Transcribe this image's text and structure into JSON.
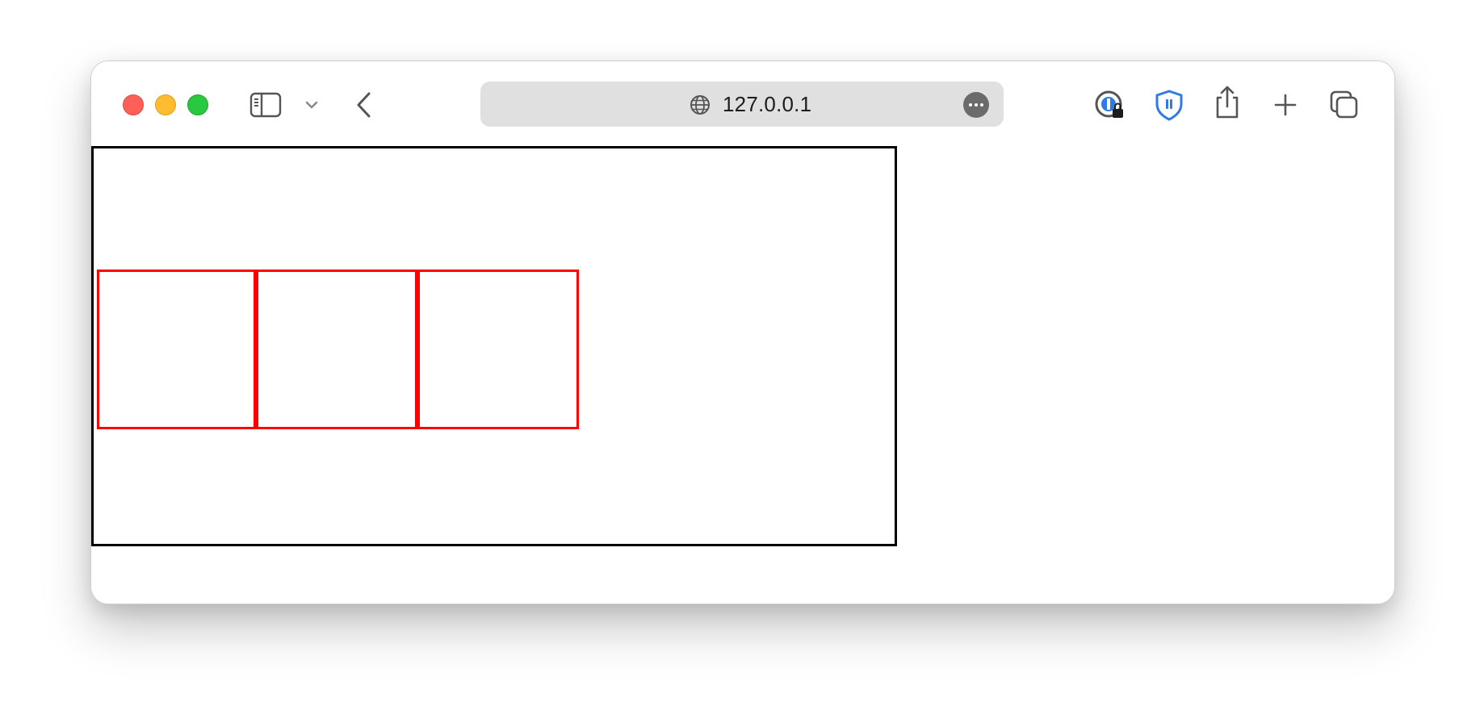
{
  "browser": {
    "address_bar": {
      "url": "127.0.0.1"
    },
    "icons": {
      "sidebar": "sidebar-icon",
      "chevron": "chevron-down-icon",
      "back": "back-arrow-icon",
      "globe": "globe-icon",
      "more": "ellipsis-icon",
      "ext1": "password-manager-icon",
      "ext2": "shield-extension-icon",
      "share": "share-icon",
      "new_tab": "plus-icon",
      "tabs": "tab-overview-icon"
    },
    "colors": {
      "close": "#fe5f57",
      "minimize": "#febc2e",
      "maximize": "#28c840",
      "accent_blue": "#2f7be5"
    }
  },
  "page": {
    "outer_box_color": "#000000",
    "red_box_color": "#ff0000",
    "red_box_count": 3
  }
}
